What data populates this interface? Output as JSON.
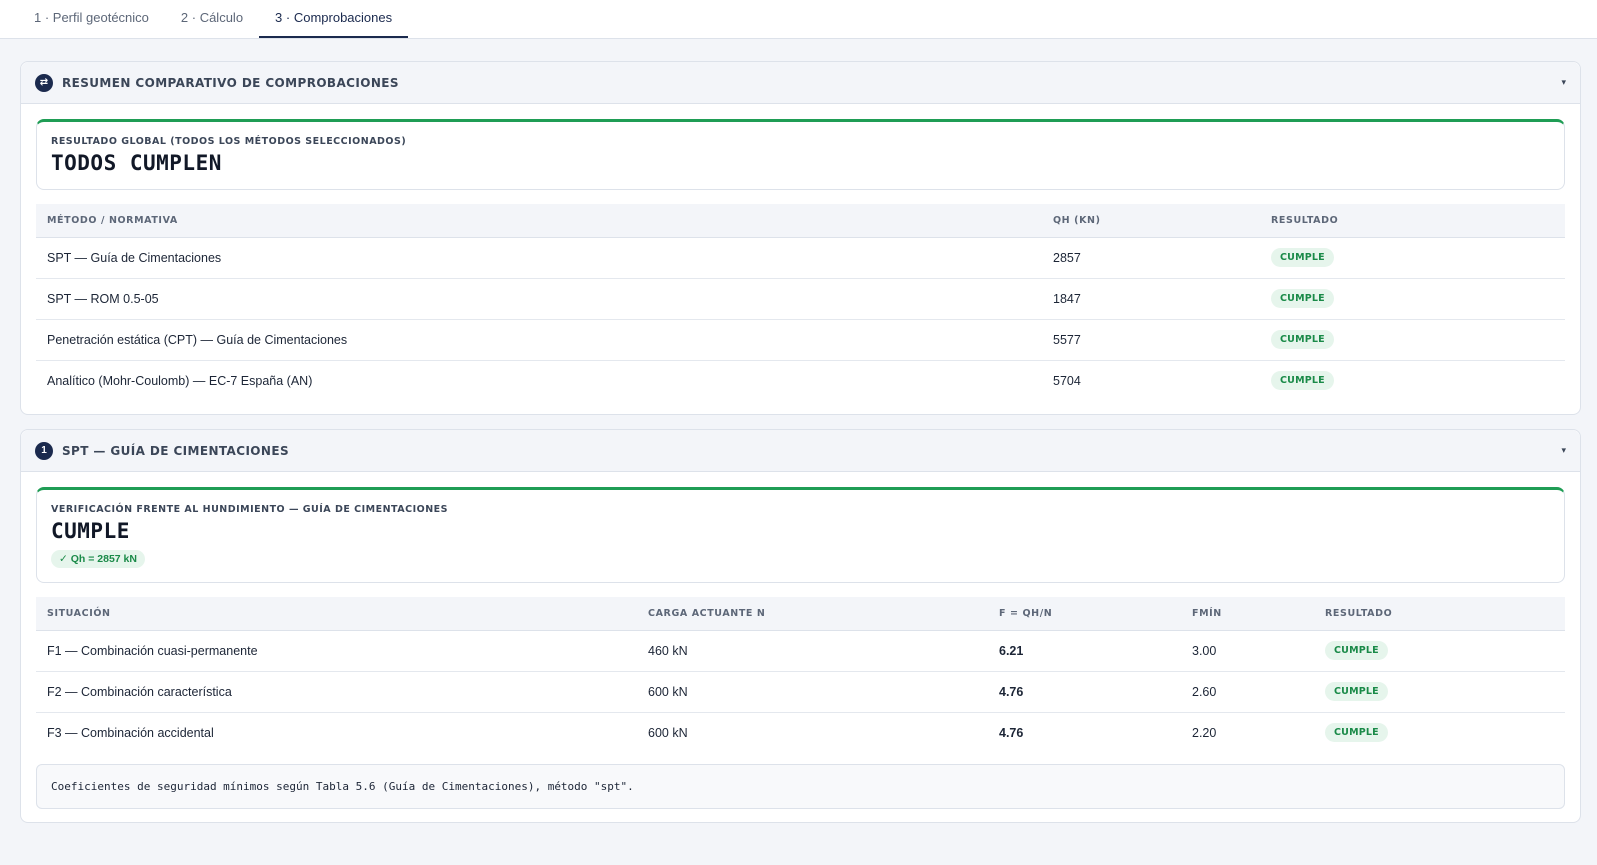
{
  "tabs": [
    {
      "label": "1 · Perfil geotécnico"
    },
    {
      "label": "2 · Cálculo"
    },
    {
      "label": "3 · Comprobaciones"
    }
  ],
  "summary": {
    "icon": "⇄",
    "title": "RESUMEN COMPARATIVO DE COMPROBACIONES",
    "result_label": "RESULTADO GLOBAL (TODOS LOS MÉTODOS SELECCIONADOS)",
    "result_value": "TODOS CUMPLEN",
    "columns": [
      "MÉTODO / NORMATIVA",
      "QH (KN)",
      "RESULTADO"
    ],
    "rows": [
      {
        "method": "SPT — Guía de Cimentaciones",
        "qh": "2857",
        "result": "CUMPLE"
      },
      {
        "method": "SPT — ROM 0.5-05",
        "qh": "1847",
        "result": "CUMPLE"
      },
      {
        "method": "Penetración estática (CPT) — Guía de Cimentaciones",
        "qh": "5577",
        "result": "CUMPLE"
      },
      {
        "method": "Analítico (Mohr-Coulomb) — EC-7 España (AN)",
        "qh": "5704",
        "result": "CUMPLE"
      }
    ]
  },
  "spt": {
    "number": "1",
    "title": "SPT — GUÍA DE CIMENTACIONES",
    "result_label": "VERIFICACIÓN FRENTE AL HUNDIMIENTO — GUÍA DE CIMENTACIONES",
    "result_value": "CUMPLE",
    "pill": "✓ Qh = 2857 kN",
    "columns": [
      "SITUACIÓN",
      "CARGA ACTUANTE N",
      "F = QH/N",
      "FMÍN",
      "RESULTADO"
    ],
    "rows": [
      {
        "situation": "F1 — Combinación cuasi-permanente",
        "load": "460 kN",
        "f": "6.21",
        "fmin": "3.00",
        "result": "CUMPLE"
      },
      {
        "situation": "F2 — Combinación característica",
        "load": "600 kN",
        "f": "4.76",
        "fmin": "2.60",
        "result": "CUMPLE"
      },
      {
        "situation": "F3 — Combinación accidental",
        "load": "600 kN",
        "f": "4.76",
        "fmin": "2.20",
        "result": "CUMPLE"
      }
    ],
    "note": "Coeficientes de seguridad mínimos según Tabla 5.6 (Guía de Cimentaciones), método \"spt\"."
  },
  "colors": {
    "accent": "#1b2a4e",
    "ok": "#1f9d55",
    "ok_bg": "#e6f5ec"
  },
  "icons": {
    "summary": "swap-arrows-icon",
    "caret": "chevron-down-icon"
  }
}
